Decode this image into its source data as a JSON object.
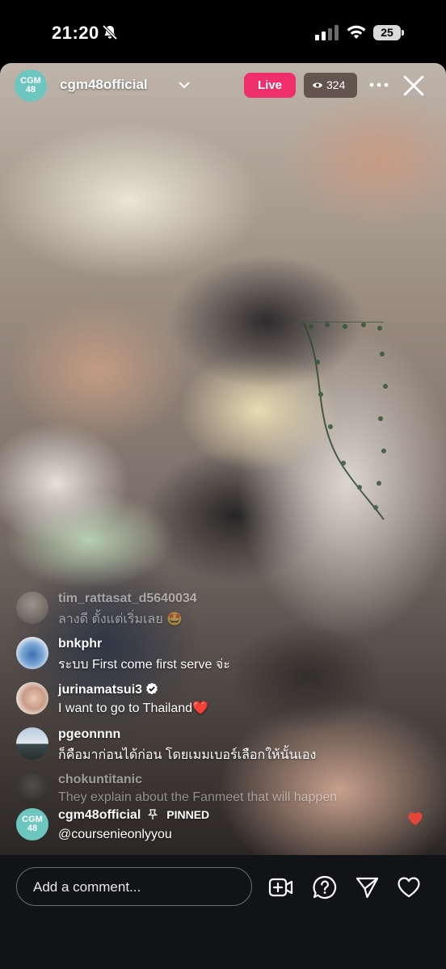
{
  "status_bar": {
    "time": "21:20",
    "battery": "25"
  },
  "stream": {
    "host_logo": "CGM 48",
    "host_name": "cgm48official",
    "live_label": "Live",
    "viewer_count": "324"
  },
  "comments": [
    {
      "user": "tim_rattasat_d5640034",
      "text": "ลางดี ตั้งแต่เริ่มเลย 🤩",
      "faded": true
    },
    {
      "user": "bnkphr",
      "text": "ระบบ First come first serve จ่ะ"
    },
    {
      "user": "jurinamatsui3",
      "text": "I want to go to Thailand❤️",
      "verified": true
    },
    {
      "user": "pgeonnnn",
      "text": "ก็คือมาก่อนได้ก่อน โดยเมมเบอร์เลือกให้นั้นเอง"
    },
    {
      "user": "chokuntitanic",
      "text": "They explain about the Fanmeet that will happen",
      "faded": true
    }
  ],
  "pinned": {
    "user": "cgm48official",
    "label": "PINNED",
    "text": "@coursenieonlyyou",
    "logo": "CGM 48"
  },
  "bottom_bar": {
    "placeholder": "Add a comment..."
  },
  "colors": {
    "live": "#ef2f6b",
    "logo": "#6ec6c1",
    "bar": "#121316"
  }
}
